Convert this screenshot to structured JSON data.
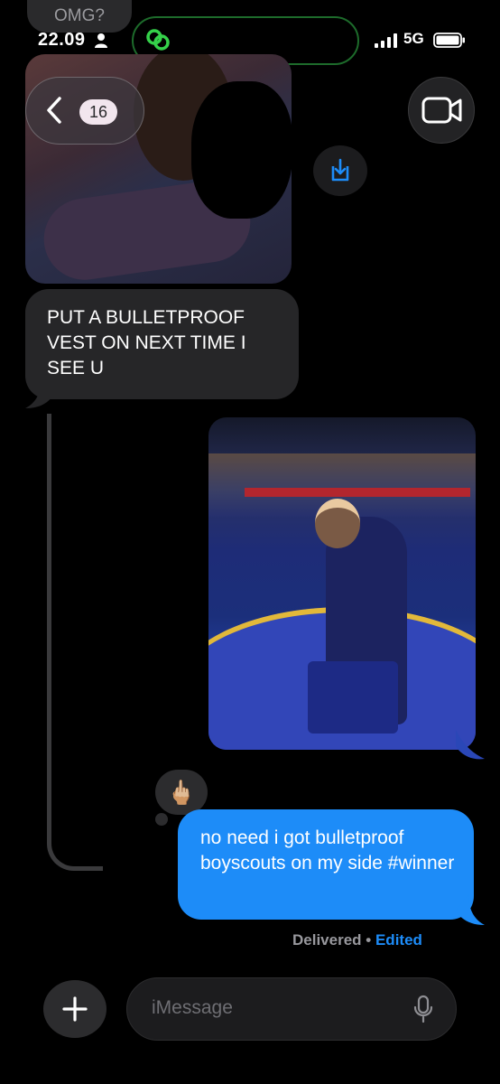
{
  "status_bar": {
    "notification": "OMG?",
    "time": "22.09",
    "network": "5G",
    "icons": [
      "person-icon",
      "signal-icon",
      "battery-icon",
      "link-icon"
    ]
  },
  "header": {
    "back_badge": "16",
    "icons": [
      "chevron-left-icon",
      "video-camera-icon",
      "save-icon"
    ]
  },
  "messages": [
    {
      "direction": "incoming",
      "type": "image"
    },
    {
      "direction": "incoming",
      "type": "text",
      "text": "PUT A BULLETPROOF VEST ON NEXT TIME I SEE U"
    },
    {
      "direction": "outgoing",
      "type": "image"
    },
    {
      "direction": "outgoing",
      "type": "text",
      "text": "no need i got bulletproof boyscouts on my side #winner",
      "reaction": "🖕🏼"
    }
  ],
  "delivery": {
    "status": "Delivered",
    "separator": "•",
    "edited": "Edited"
  },
  "composer": {
    "placeholder": "iMessage",
    "icons": [
      "plus-icon",
      "microphone-icon"
    ]
  },
  "colors": {
    "bubble_outgoing": "#1d8cf8",
    "bubble_incoming": "#262628",
    "edited_link": "#1d8cf8",
    "island_border": "#1d6b2b"
  }
}
